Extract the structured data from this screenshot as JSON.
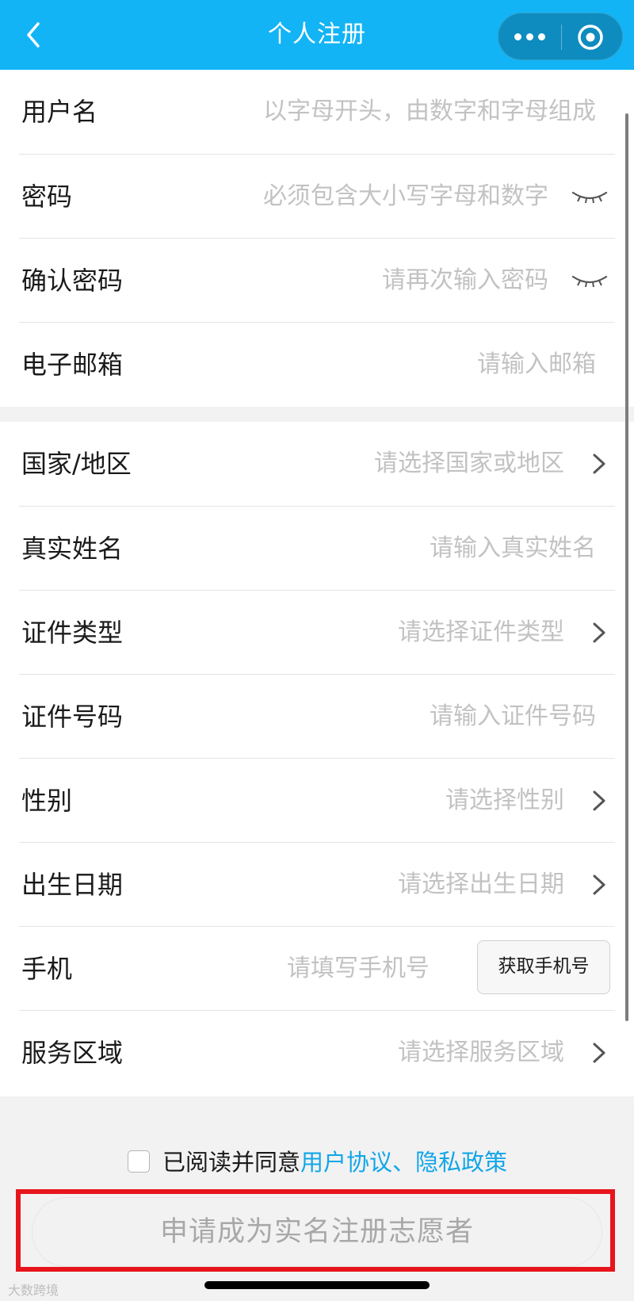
{
  "nav": {
    "title": "个人注册"
  },
  "account_fields": [
    {
      "label": "用户名",
      "placeholder": "以字母开头，由数字和字母组成"
    },
    {
      "label": "密码",
      "placeholder": "必须包含大小写字母和数字"
    },
    {
      "label": "确认密码",
      "placeholder": "请再次输入密码"
    },
    {
      "label": "电子邮箱",
      "placeholder": "请输入邮箱"
    }
  ],
  "profile_fields": [
    {
      "label": "国家/地区",
      "placeholder": "请选择国家或地区"
    },
    {
      "label": "真实姓名",
      "placeholder": "请输入真实姓名"
    },
    {
      "label": "证件类型",
      "placeholder": "请选择证件类型"
    },
    {
      "label": "证件号码",
      "placeholder": "请输入证件号码"
    },
    {
      "label": "性别",
      "placeholder": "请选择性别"
    },
    {
      "label": "出生日期",
      "placeholder": "请选择出生日期"
    },
    {
      "label": "手机",
      "placeholder": "请填写手机号",
      "button": "获取手机号"
    },
    {
      "label": "服务区域",
      "placeholder": "请选择服务区域"
    }
  ],
  "agreement": {
    "prefix": "已阅读并同意",
    "link": "用户协议、隐私政策",
    "checked": false
  },
  "submit": {
    "label": "申请成为实名注册志愿者"
  },
  "watermark": "大数跨境",
  "colors": {
    "nav_bg": "#12b4f5",
    "link": "#12a6e8",
    "highlight": "#e8141c"
  }
}
